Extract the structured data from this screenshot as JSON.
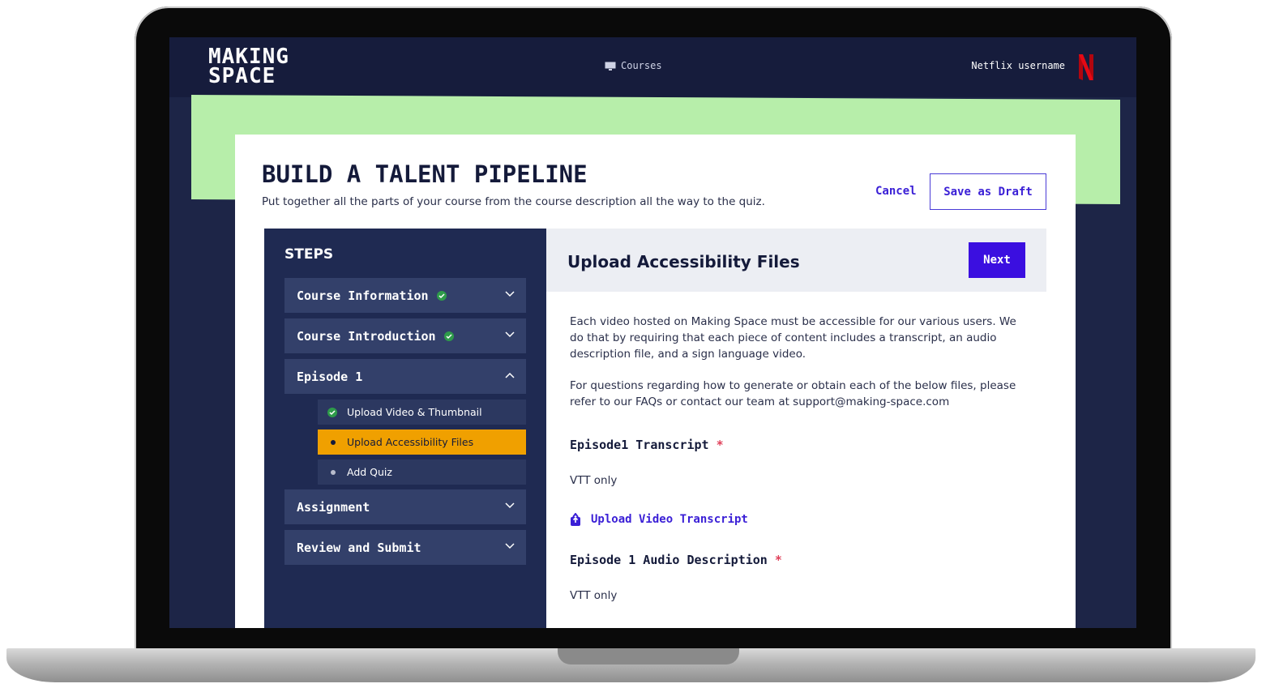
{
  "header": {
    "logo": "MAKING SPACE",
    "logo_line1": "MAKING",
    "logo_line2": "SPACE",
    "nav_courses": "Courses",
    "username": "Netflix username"
  },
  "page": {
    "title": "BUILD A TALENT PIPELINE",
    "subtitle": "Put together all the parts of your course from the course description all the way to the quiz.",
    "cancel_label": "Cancel",
    "save_draft_label": "Save as Draft"
  },
  "steps": {
    "title": "STEPS",
    "items": [
      {
        "label": "Course Information",
        "completed": true,
        "expanded": false
      },
      {
        "label": "Course Introduction",
        "completed": true,
        "expanded": false
      },
      {
        "label": "Episode 1",
        "completed": false,
        "expanded": true
      },
      {
        "label": "Assignment",
        "completed": false,
        "expanded": false
      },
      {
        "label": "Review and Submit",
        "completed": false,
        "expanded": false
      }
    ],
    "episode_substeps": [
      {
        "label": "Upload Video & Thumbnail",
        "status": "completed"
      },
      {
        "label": "Upload Accessibility Files",
        "status": "current"
      },
      {
        "label": "Add Quiz",
        "status": "pending"
      }
    ]
  },
  "content": {
    "title": "Upload Accessibility Files",
    "next_label": "Next",
    "paragraph1": "Each video hosted on Making Space must be accessible for our various users. We do that by requiring that each piece of content includes a transcript, an audio description file, and a sign language video.",
    "paragraph2": "For questions regarding how to generate or obtain each of the below files, please refer to our FAQs or contact our team at support@making-space.com",
    "fields": [
      {
        "label": "Episode1 Transcript",
        "required_mark": "*",
        "hint": "VTT only",
        "upload_label": "Upload Video Transcript"
      },
      {
        "label": "Episode 1 Audio Description",
        "required_mark": "*",
        "hint": "VTT only"
      }
    ]
  },
  "colors": {
    "accent": "#3b0fe0",
    "active_step": "#f0a000",
    "banner_green": "#b7eeaa",
    "navy": "#1d2547",
    "success": "#2e9b4a",
    "required": "#e0405a"
  }
}
